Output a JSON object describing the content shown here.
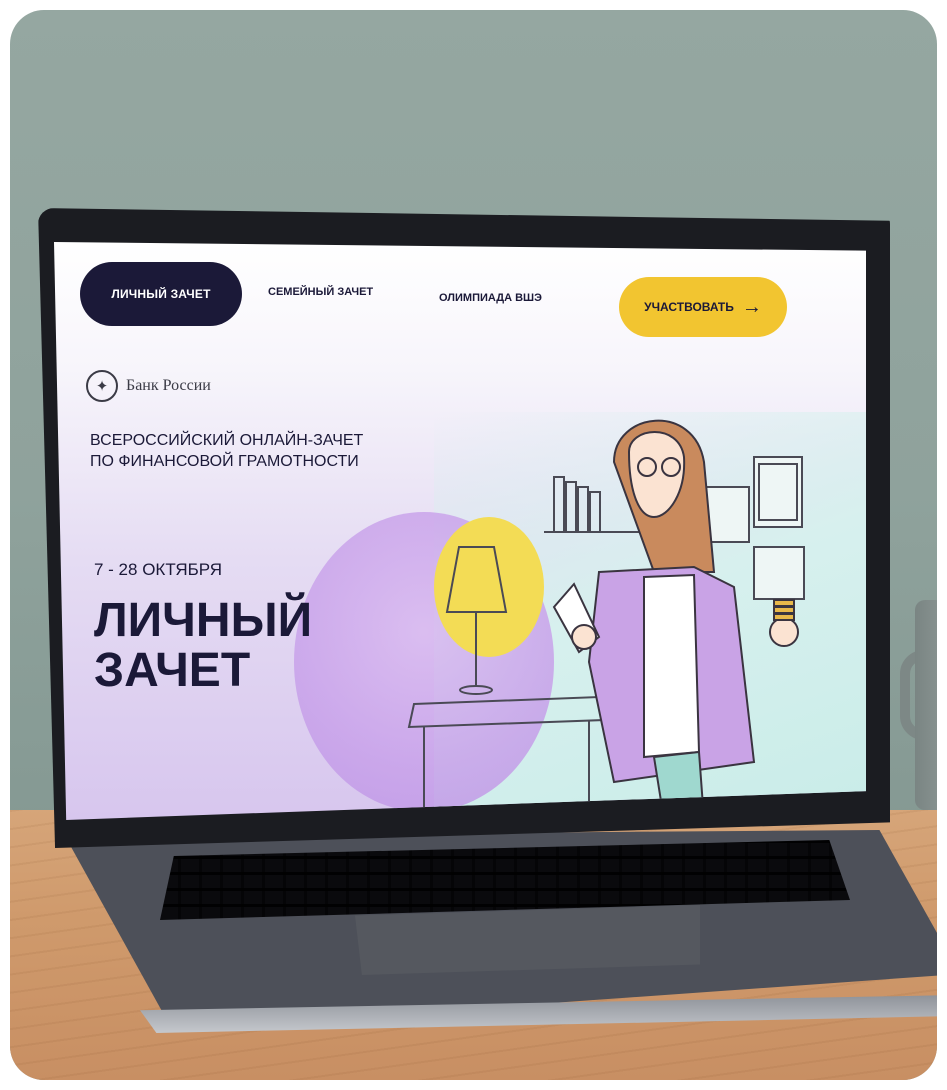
{
  "nav": {
    "tab_personal": "ЛИЧНЫЙ ЗАЧЕТ",
    "tab_family": "СЕМЕЙНЫЙ ЗАЧЕТ",
    "tab_olympiad": "ОЛИМПИАДА ВШЭ",
    "cta": "УЧАСТВОВАТЬ",
    "cta_arrow": "→"
  },
  "brand": {
    "name": "Банк России",
    "emblem_icon": "eagle-emblem-icon"
  },
  "hero": {
    "subtitle_line1": "ВСЕРОССИЙСКИЙ ОНЛАЙН-ЗАЧЕТ",
    "subtitle_line2": "ПО ФИНАНСОВОЙ ГРАМОТНОСТИ",
    "dates": "7 - 28 ОКТЯБРЯ",
    "title_line1": "ЛИЧНЫЙ",
    "title_line2": "ЗАЧЕТ"
  },
  "colors": {
    "navy": "#1b1938",
    "cta_yellow": "#f2c530",
    "purple": "#c8a1ea",
    "mint": "#c8ece8"
  }
}
